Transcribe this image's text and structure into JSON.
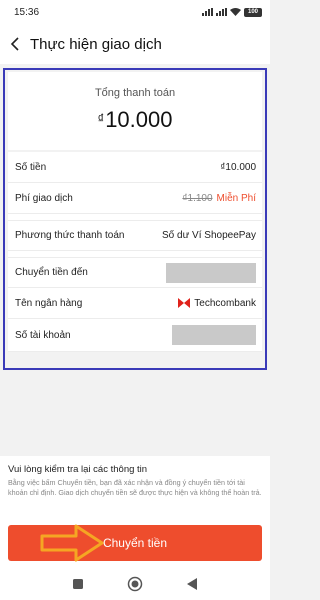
{
  "status_bar": {
    "time": "15:36",
    "battery": "100"
  },
  "header": {
    "title": "Thực hiện giao dịch"
  },
  "summary": {
    "label": "Tổng thanh toán",
    "currency": "₫",
    "amount": "10.000"
  },
  "rows": {
    "amount_label": "Số tiền",
    "amount_value": "₫10.000",
    "fee_label": "Phí giao dịch",
    "fee_old": "₫1.100",
    "fee_value": "Miễn Phí",
    "method_label": "Phương thức thanh toán",
    "method_value": "Số dư Ví ShopeePay",
    "to_label": "Chuyển tiền đến",
    "bank_label": "Tên ngân hàng",
    "bank_value": "Techcombank",
    "account_label": "Số tài khoản"
  },
  "notice": {
    "title": "Vui lòng kiểm tra lại các thông tin",
    "body": "Bằng việc bấm Chuyển tiền, bạn đã xác nhận và đồng ý chuyển tiền tới tài khoản chỉ định. Giao dịch chuyển tiền sẽ được thực hiện và không thể hoàn trả."
  },
  "footer": {
    "button_label": "Chuyển tiền"
  },
  "colors": {
    "accent": "#ee4d2d",
    "highlight_border": "#3a3ab8",
    "arrow": "#f5a623"
  },
  "icons": [
    "back-arrow-icon",
    "signal-icon",
    "wifi-icon",
    "battery-icon",
    "techcombank-logo",
    "square-nav-icon",
    "home-nav-icon",
    "back-nav-icon"
  ]
}
